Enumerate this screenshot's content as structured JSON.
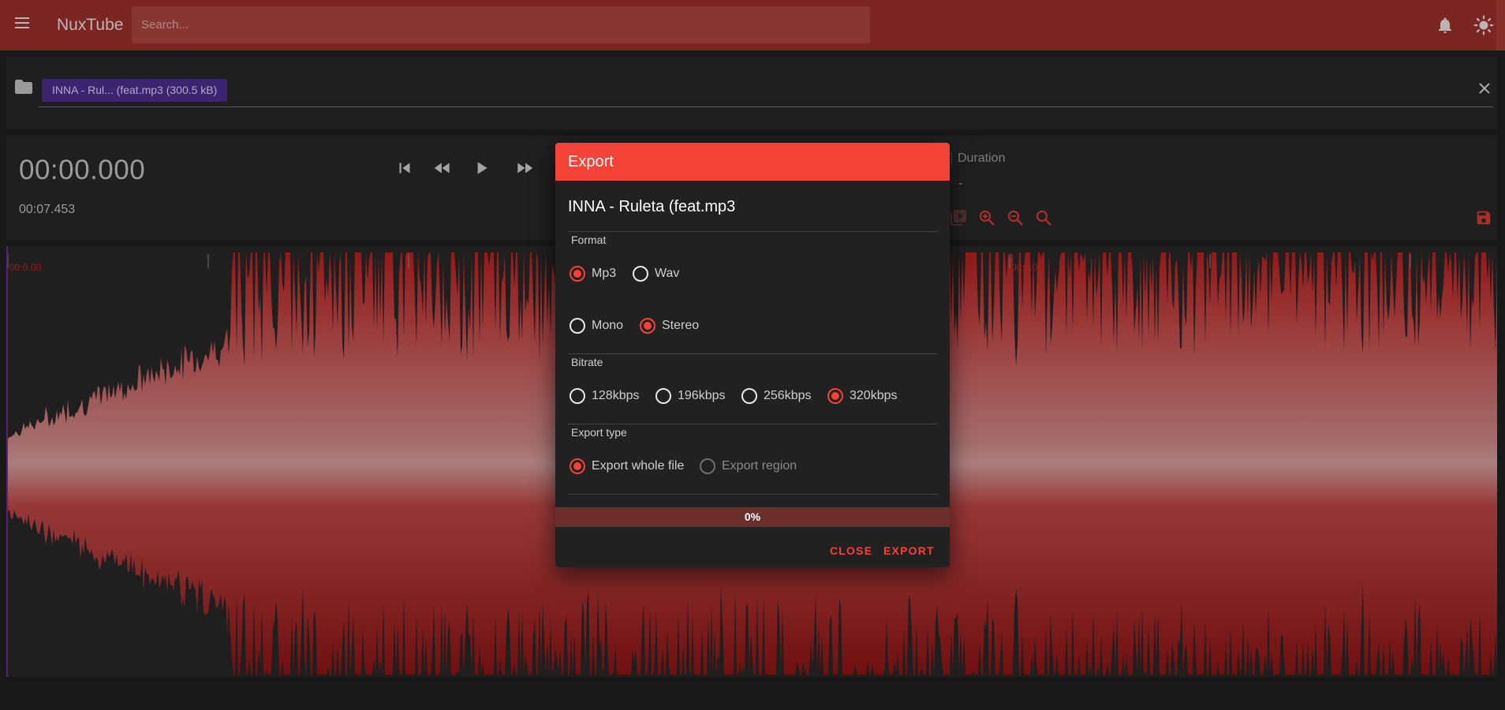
{
  "app": {
    "title": "NuxTube"
  },
  "search": {
    "placeholder": "Search..."
  },
  "file_chip": {
    "label": "INNA - Rul... (feat.mp3 (300.5 kB)"
  },
  "player": {
    "current_time": "00:00.000",
    "total_time": "00:07.453",
    "duration_label": "Duration",
    "duration_value": "-"
  },
  "waveform": {
    "tick_labels": [
      "00:0.00",
      "00:5.00"
    ],
    "color": "#b51f1f"
  },
  "dialog": {
    "title": "Export",
    "filename": "INNA - Ruleta (feat.mp3",
    "format_label": "Format",
    "format_options": [
      "Mp3",
      "Wav"
    ],
    "format_selected": "Mp3",
    "channel_options": [
      "Mono",
      "Stereo"
    ],
    "channel_selected": "Stereo",
    "bitrate_label": "Bitrate",
    "bitrate_options": [
      "128kbps",
      "196kbps",
      "256kbps",
      "320kbps"
    ],
    "bitrate_selected": "320kbps",
    "export_type_label": "Export type",
    "export_type_options": [
      "Export whole file",
      "Export region"
    ],
    "export_type_selected": "Export whole file",
    "progress": 0,
    "progress_text": "0%",
    "close_label": "CLOSE",
    "export_label": "EXPORT"
  },
  "colors": {
    "accent": "#f44336",
    "topbar": "#962f2b",
    "chip": "#4a2d8a"
  },
  "icons": [
    "menu-icon",
    "bell-icon",
    "sun-icon",
    "folder-icon",
    "close-icon",
    "skip-previous-icon",
    "rewind-icon",
    "play-icon",
    "fast-forward-icon",
    "play-region-icon",
    "zoom-in-icon",
    "zoom-out-icon",
    "zoom-reset-icon",
    "save-icon"
  ]
}
